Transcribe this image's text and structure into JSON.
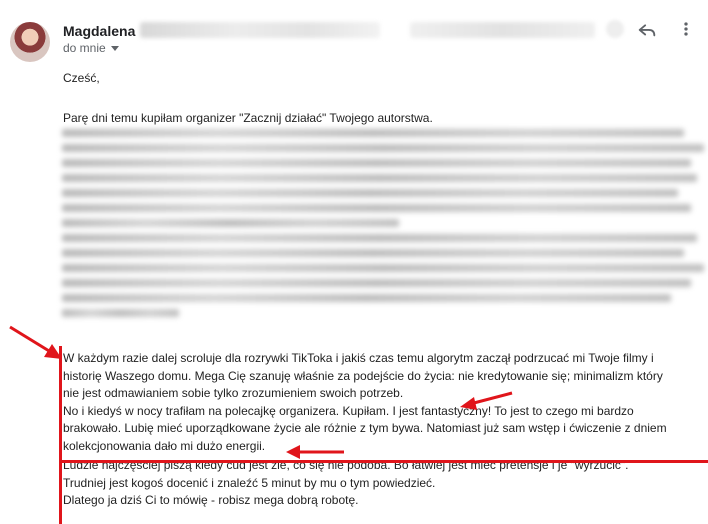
{
  "header": {
    "sender_name": "Magdalena",
    "recipient_label": "do mnie",
    "icons": {
      "avatar": "avatar",
      "reply": "reply-icon",
      "more": "more-vertical-icon",
      "dropdown": "caret-down-icon"
    }
  },
  "email": {
    "greeting": "Cześć,",
    "intro": "Parę dni temu kupiłam organizer \"Zacznij działać\" Twojego autorstwa.",
    "paragraph1": [
      "W każdym razie dalej scroluje dla rozrywki TikToka i jakiś czas temu algorytm zaczął podrzucać mi Twoje filmy i",
      "historię Waszego domu. Mega Cię szanuję właśnie za podejście do życia: nie kredytowanie się; minimalizm który",
      "nie jest odmawianiem sobie tylko zrozumieniem swoich potrzeb.",
      "No i kiedyś w nocy trafiłam na polecajkę organizera. Kupiłam. I jest fantastyczny! To jest to czego mi bardzo",
      "brakowało. Lubię mieć uporządkowane życie ale różnie z tym bywa. Natomiast już sam wstęp i ćwiczenie z dniem",
      "kolekcjonowania dało mi dużo energii."
    ],
    "paragraph2": [
      "Ludzie najczęściej piszą kiedy cud jest źle, co się nie podoba. Bo łatwiej jest mieć pretensje i je \"wyrzucić\".",
      "Trudniej jest kogoś docenić i znaleźć 5 minut by mu o tym powiedzieć.",
      "Dlatego ja dziś Ci to mówię - robisz mega dobrą robotę."
    ]
  },
  "annotation": {
    "color": "#e0151b"
  }
}
